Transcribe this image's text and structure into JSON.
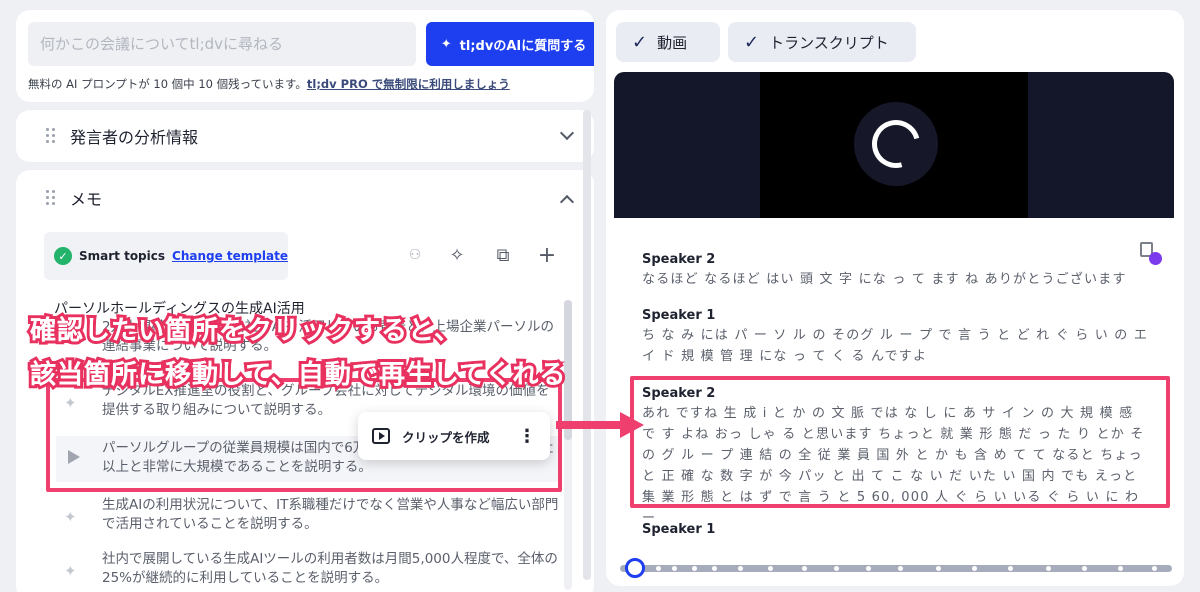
{
  "ask": {
    "placeholder": "何かこの会議についてtl;dvに尋ねる",
    "button_label": "tl;dvのAIに質問する",
    "note_prefix": "無料の AI プロンプトが 10 個中 10 個残っています。",
    "note_link": "tl;dv PRO で無制限に利用しましょう"
  },
  "speaker_section": {
    "title": "発言者の分析情報"
  },
  "memo_section": {
    "title": "メモ",
    "smart_topics_label": "Smart topics",
    "change_template": "Change template",
    "topic_heading": "パーソルホールディングスの生成AI活用",
    "bullets": [
      {
        "text": "2万人規模のグループ会社でAIを活用している背景と、上場企業パーソルの連結事業について説明する。"
      },
      {
        "text": "デジタルEX推進室の役割と、グループ会社に対してデジタル環境の価値を提供する取り組みについて説明する。"
      },
      {
        "text": "パーソルグループの従業員規模は国内で6万人以上、グループ会社は230社以上と非常に大規模であることを説明する。"
      },
      {
        "text": "生成AIの利用状況について、IT系職種だけでなく営業や人事など幅広い部門で活用されていることを説明する。"
      },
      {
        "text": "社内で展開している生成AIツールの利用者数は月間5,000人程度で、全体の25%が継続的に利用していることを説明する。"
      }
    ],
    "clip_popup_label": "クリップを作成"
  },
  "right": {
    "tabs": [
      {
        "label": "動画"
      },
      {
        "label": "トランスクリプト"
      }
    ],
    "transcript": [
      {
        "speaker": "Speaker 2",
        "text": "なるほど なるほど はい 頭 文 字 にな っ て ます ね ありがとうございます"
      },
      {
        "speaker": "Speaker 1",
        "text": "ち な み には パ ー ソ ル の そのグ ル ー プ で 言 う と ど れ ぐ ら い の エ イ ド 規 模 管 理 にな っ て く る んですよ"
      },
      {
        "speaker": "Speaker 2",
        "text": "あれ ですね 生 成 i と か の 文 脈 では な し に あ サ イ ン の 大 規 模 感 で す よね おっ しゃ る と思います ちょっと 就 業 形 態 だ っ た り とか そ の グ ル ー プ 連 結 の 全 従 業 員 国 外 と か も 含 め て て なると ちょっと 正 確 な 数 字 が 今 パッ と 出 て こ な い だ いた い 国 内 でも えっと 集 業 形 態 と は ず で 言 う と 5 60, 000 人 ぐ ら い いる ぐ ら い に わ ー"
      },
      {
        "speaker": "Speaker 1",
        "text": ""
      }
    ],
    "playback_progress": 0.01
  },
  "annotation": {
    "line1": "確認したい箇所をクリックすると、",
    "line2": "該当箇所に移動して、自動で再生してくれる",
    "color": "#ee3f6e"
  },
  "colors": {
    "accent": "#1e3ff0",
    "success": "#24b36b",
    "highlight": "#ee3f6e"
  }
}
